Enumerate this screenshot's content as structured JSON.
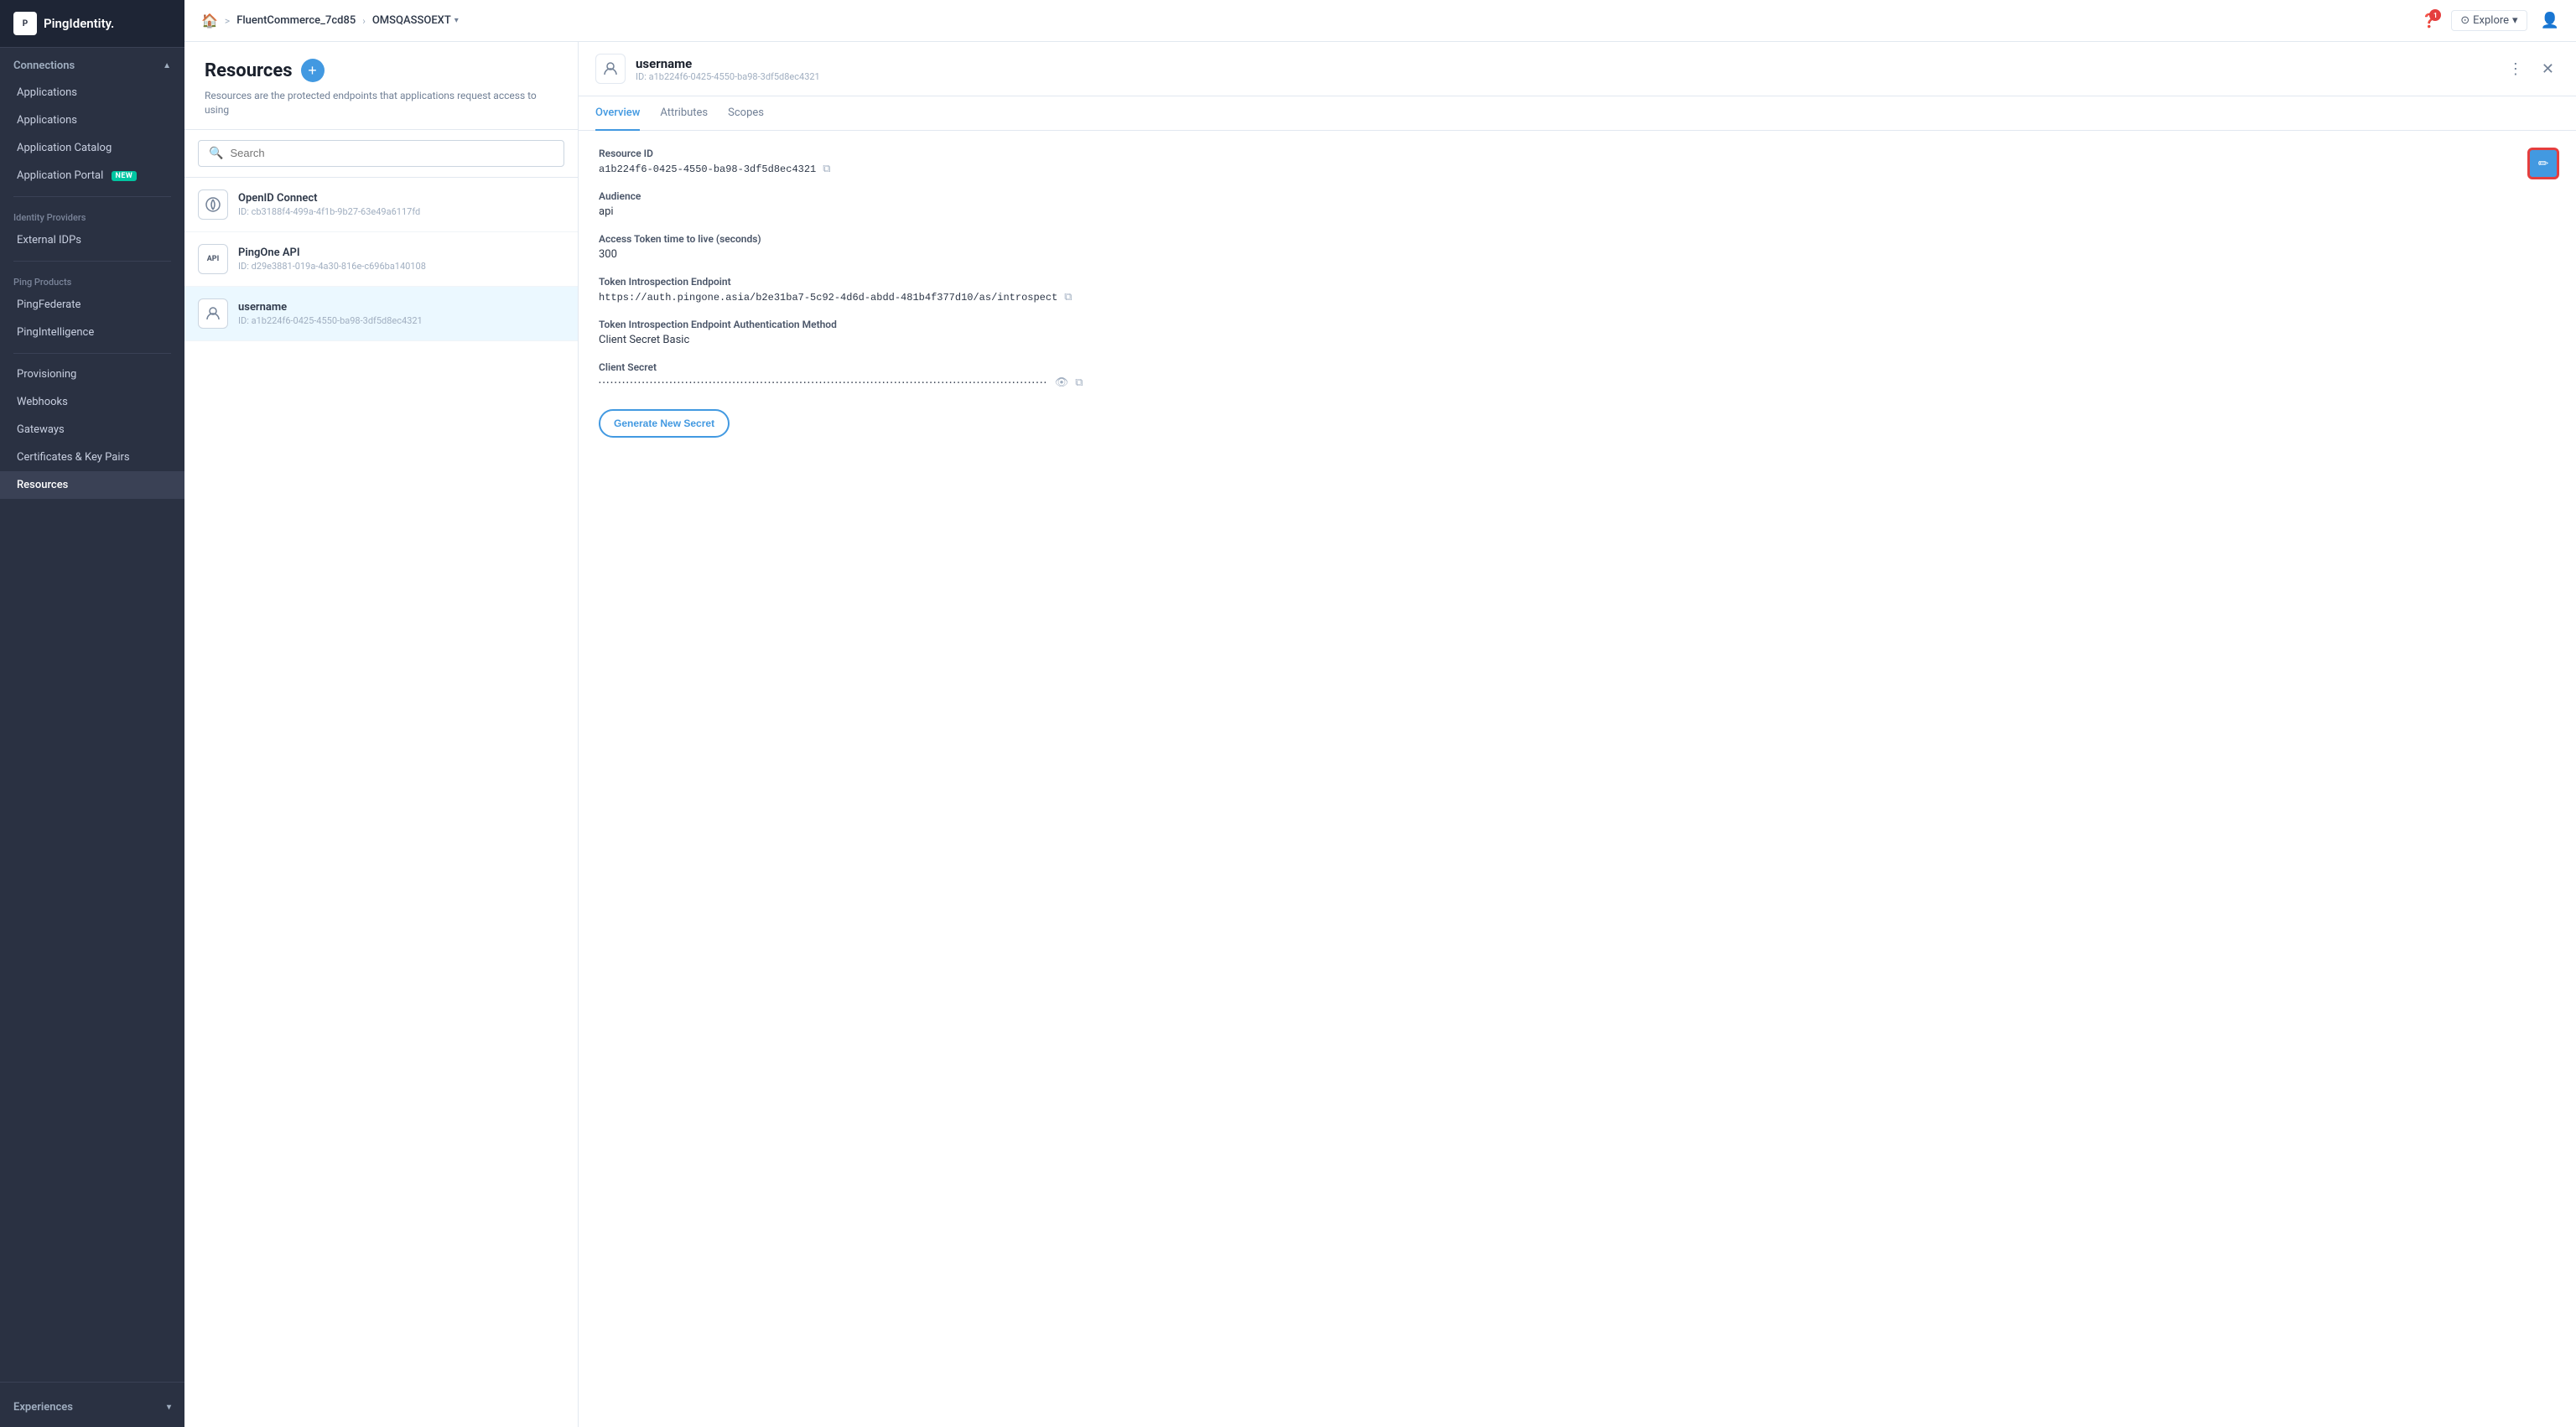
{
  "sidebar": {
    "logo": {
      "icon": "P",
      "text": "PingIdentity."
    },
    "sections": [
      {
        "label": "Connections",
        "chevron": "▲",
        "items": [
          {
            "id": "applications-sub",
            "label": "Applications",
            "active": false,
            "indent": true
          },
          {
            "id": "applications",
            "label": "Applications",
            "active": false
          },
          {
            "id": "application-catalog",
            "label": "Application Catalog",
            "active": false
          },
          {
            "id": "application-portal",
            "label": "Application Portal",
            "active": false,
            "badge": "NEW"
          }
        ]
      },
      {
        "label": "Identity Providers",
        "items": [
          {
            "id": "external-idps",
            "label": "External IDPs",
            "active": false
          }
        ]
      },
      {
        "label": "Ping Products",
        "items": [
          {
            "id": "pingfederate",
            "label": "PingFederate",
            "active": false
          },
          {
            "id": "pingintelligence",
            "label": "PingIntelligence",
            "active": false
          }
        ]
      },
      {
        "label": "",
        "items": [
          {
            "id": "provisioning",
            "label": "Provisioning",
            "active": false
          },
          {
            "id": "webhooks",
            "label": "Webhooks",
            "active": false
          },
          {
            "id": "gateways",
            "label": "Gateways",
            "active": false
          },
          {
            "id": "certificates-key-pairs",
            "label": "Certificates & Key Pairs",
            "active": false
          },
          {
            "id": "resources",
            "label": "Resources",
            "active": true
          }
        ]
      }
    ],
    "bottom_section": {
      "label": "Experiences",
      "chevron": "▼"
    }
  },
  "topbar": {
    "home_icon": "🏠",
    "env_name": "FluentCommerce_7cd85",
    "separator": ">",
    "current_env": "OMSQASSOEXT",
    "dropdown_icon": "▾",
    "help_badge": "1",
    "explore_label": "Explore",
    "explore_icon": "▾"
  },
  "resources_pane": {
    "title": "Resources",
    "description": "Resources are the protected endpoints that applications request access to using",
    "search_placeholder": "Search",
    "items": [
      {
        "id": "openid-connect",
        "icon_type": "oidc",
        "icon_label": "⊙",
        "name": "OpenID Connect",
        "resource_id": "ID: cb3188f4-499a-4f1b-9b27-63e49a6117fd"
      },
      {
        "id": "pingone-api",
        "icon_type": "api",
        "icon_label": "API",
        "name": "PingOne API",
        "resource_id": "ID: d29e3881-019a-4a30-816e-c696ba140108"
      },
      {
        "id": "username",
        "icon_type": "user",
        "icon_label": "👤",
        "name": "username",
        "resource_id": "ID: a1b224f6-0425-4550-ba98-3df5d8ec4321",
        "selected": true
      }
    ]
  },
  "detail_pane": {
    "header": {
      "icon": "👤",
      "name": "username",
      "id_label": "ID: a1b224f6-0425-4550-ba98-3df5d8ec4321"
    },
    "tabs": [
      {
        "id": "overview",
        "label": "Overview",
        "active": true
      },
      {
        "id": "attributes",
        "label": "Attributes",
        "active": false
      },
      {
        "id": "scopes",
        "label": "Scopes",
        "active": false
      }
    ],
    "fields": [
      {
        "id": "resource-id",
        "label": "Resource ID",
        "value": "a1b224f6-0425-4550-ba98-3df5d8ec4321",
        "has_copy": true,
        "mono": true
      },
      {
        "id": "audience",
        "label": "Audience",
        "value": "api",
        "has_copy": false
      },
      {
        "id": "access-token-ttl",
        "label": "Access Token time to live (seconds)",
        "value": "300",
        "has_copy": false
      },
      {
        "id": "token-introspection-endpoint",
        "label": "Token Introspection Endpoint",
        "value": "https://auth.pingone.asia/b2e31ba7-5c92-4d6d-abdd-481b4f377d10/as/introspect",
        "has_copy": true,
        "mono": true
      },
      {
        "id": "token-introspection-auth-method",
        "label": "Token Introspection Endpoint Authentication Method",
        "value": "Client Secret Basic",
        "has_copy": false
      },
      {
        "id": "client-secret",
        "label": "Client Secret",
        "value": "••••••••••••••••••••••••••••••••••••••••••••••••••••••••••••••••••••••••••••••••••••••••••••••••••••••••••••••••••",
        "has_copy": true,
        "has_hide": true,
        "is_secret": true
      }
    ],
    "generate_btn_label": "Generate New Secret",
    "edit_icon": "✏"
  }
}
